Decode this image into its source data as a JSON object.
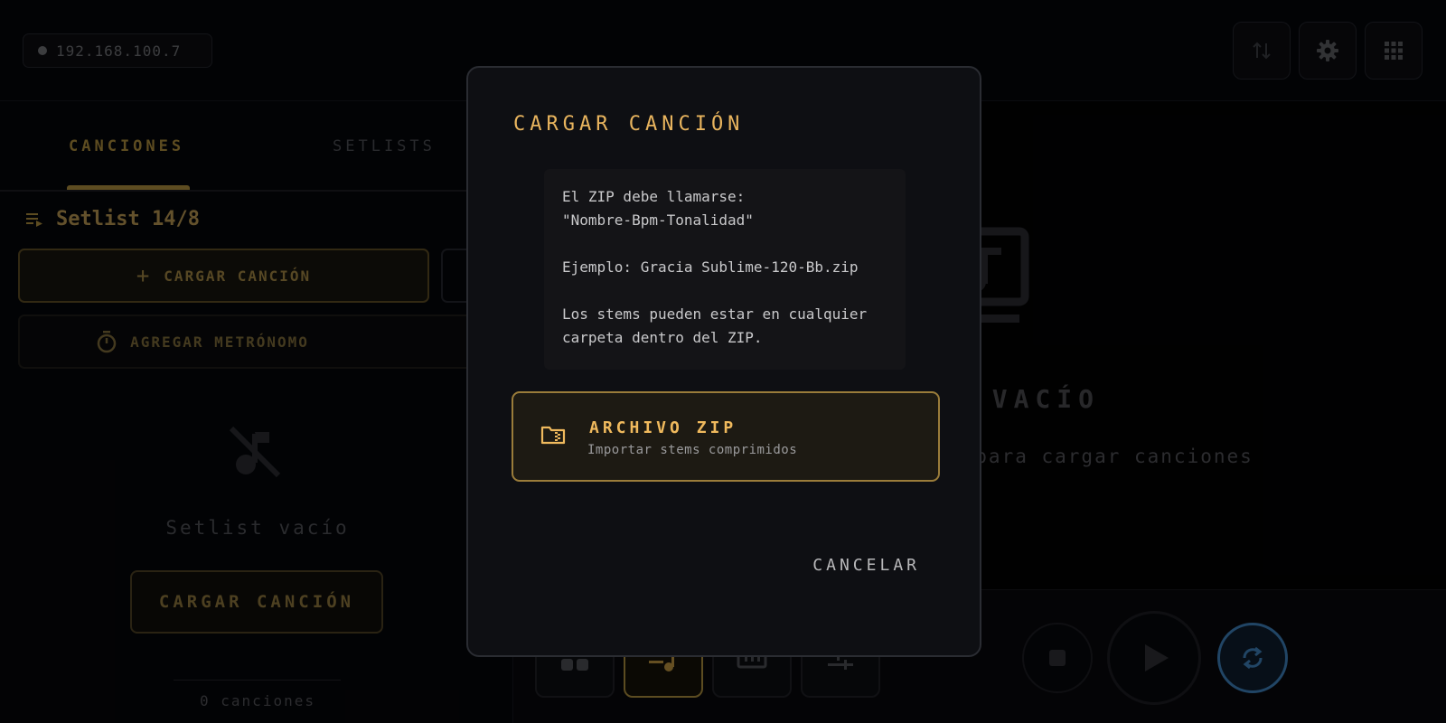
{
  "topbar": {
    "ip_address": "192.168.100.7",
    "icons": [
      "sort-arrows-icon",
      "gear-icon",
      "grid-icon"
    ]
  },
  "left_panel": {
    "tabs": [
      {
        "label": "CANCIONES",
        "active": true
      },
      {
        "label": "SETLISTS",
        "active": false
      }
    ],
    "setlist_title": "Setlist 14/8",
    "load_button": "CARGAR CANCIÓN",
    "metronome_button": "AGREGAR METRÓNOMO",
    "empty_text": "Setlist vacío",
    "empty_load_button": "CARGAR CANCIÓN",
    "song_count": "0 canciones"
  },
  "right_panel": {
    "empty_title": "T VACÍO",
    "empty_subtitle": "o para cargar canciones"
  },
  "modal": {
    "title": "CARGAR CANCIÓN",
    "info": {
      "line1": "El ZIP debe llamarse:",
      "line2": "\"Nombre-Bpm-Tonalidad\"",
      "line3": "Ejemplo: Gracia Sublime-120-Bb.zip",
      "line4": "Los stems pueden estar en cualquier",
      "line5": "carpeta dentro del ZIP."
    },
    "zip_option": {
      "title": "ARCHIVO ZIP",
      "subtitle": "Importar stems comprimidos"
    },
    "cancel": "CANCELAR"
  },
  "colors": {
    "accent_gold": "#e8b45e",
    "background": "#05060a",
    "modal_bg": "#0e0f13",
    "sync_blue": "#3d7fb8"
  }
}
